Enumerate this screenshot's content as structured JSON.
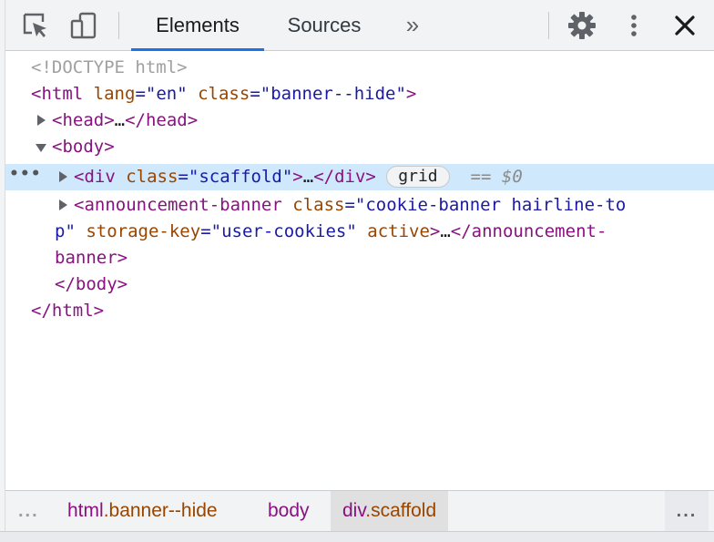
{
  "toolbar": {
    "tabs": [
      {
        "label": "Elements",
        "active": true
      },
      {
        "label": "Sources",
        "active": false
      }
    ],
    "more_tabs": "»"
  },
  "tree": {
    "doctype": "<!DOCTYPE html>",
    "html_open": {
      "lt": "<",
      "tag": "html",
      "attr1_name": "lang",
      "attr1_value": "\"en\"",
      "attr2_name": "class",
      "attr2_value": "\"banner--hide\"",
      "gt": ">"
    },
    "head": {
      "text": "<head>",
      "ellipsis": "…",
      "close": "</head>"
    },
    "body_open": "<body>",
    "div": {
      "lt": "<",
      "tag": "div",
      "attr_name": "class",
      "attr_value": "\"scaffold\"",
      "gt": ">",
      "ellipsis": "…",
      "close": "</div>",
      "badge": "grid",
      "eq": "==",
      "dollar": "$0"
    },
    "banner": {
      "lt": "<",
      "tag": "announcement-banner",
      "attr1_name": "class",
      "attr1_value_a": "\"cookie-banner hairline-to",
      "attr1_value_b": "p\"",
      "attr2_name": "storage-key",
      "attr2_value": "\"user-cookies\"",
      "attr3_name": "active",
      "gt": ">",
      "ellipsis": "…",
      "close_a": "</announcement-",
      "close_b": "banner>"
    },
    "body_close": "</body>",
    "html_close": "</html>",
    "selected_dots": "•••"
  },
  "breadcrumb": {
    "leading": "...",
    "items": [
      {
        "tag": "html",
        "cls": ".banner--hide"
      },
      {
        "tag": "body",
        "cls": ""
      },
      {
        "tag": "div",
        "cls": ".scaffold"
      }
    ],
    "trailing": "..."
  },
  "colors": {
    "tag": "#881280",
    "attr_name": "#994500",
    "attr_value": "#1a1aa6",
    "selected_row": "#cfe8fc",
    "active_tab_underline": "#1a73e8"
  },
  "icons": [
    "inspect-element-icon",
    "device-toolbar-icon",
    "gear-icon",
    "more-vertical-icon",
    "close-icon"
  ]
}
